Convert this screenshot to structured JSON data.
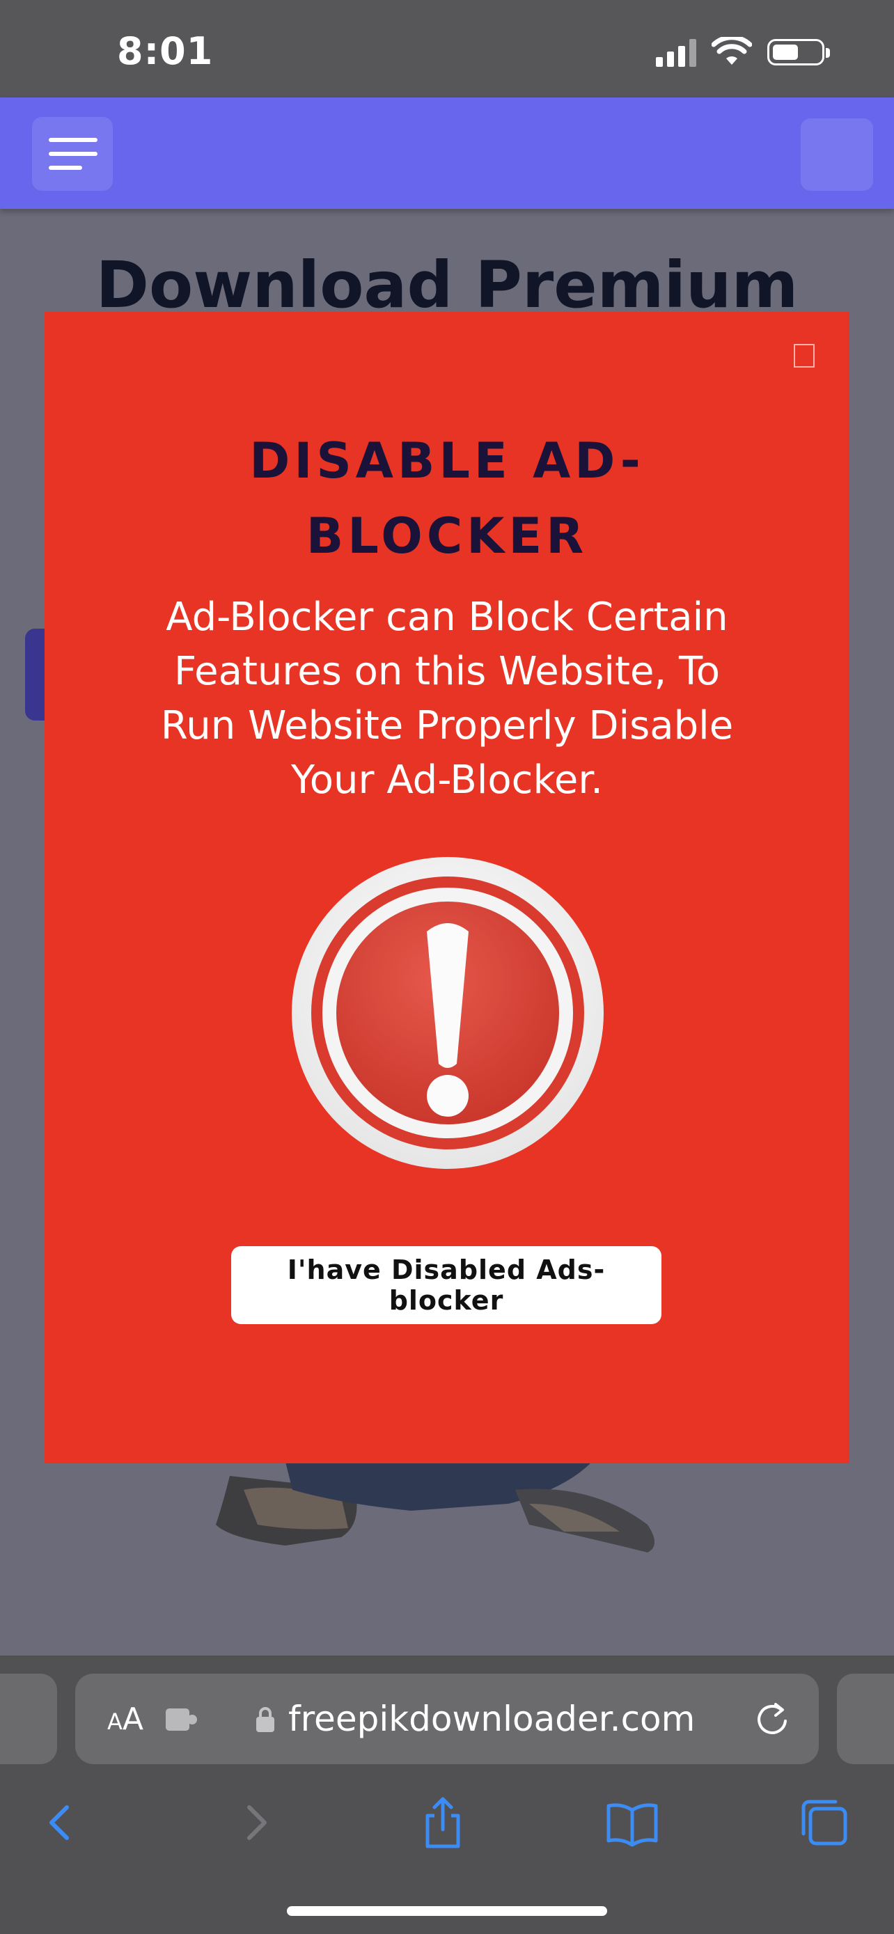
{
  "status_bar": {
    "time": "8:01"
  },
  "page": {
    "title": "Download Premium"
  },
  "modal": {
    "heading_line1": "DISABLE AD-",
    "heading_line2": "BLOCKER",
    "body_line1": "Ad-Blocker can Block Certain",
    "body_line2": "Features on this Website, To",
    "body_line3": "Run Website Properly Disable",
    "body_line4": "Your Ad-Blocker.",
    "button_label": "I'have Disabled Ads-blocker"
  },
  "browser": {
    "aa_small": "A",
    "aa_large": "A",
    "url": "freepikdownloader.com"
  },
  "icons": {
    "menu": "hamburger-icon",
    "close": "close-icon",
    "alert": "exclamation-alert-icon",
    "lock": "lock-icon",
    "extension": "puzzle-extension-icon",
    "reload": "reload-icon",
    "back": "chevron-left-icon",
    "forward": "chevron-right-icon",
    "share": "share-icon",
    "bookmarks": "book-icon",
    "tabs": "tabs-icon"
  },
  "colors": {
    "header": "#6866ec",
    "modal_bg": "#e83424",
    "heading": "#1a1239",
    "nav_accent": "#3c8cf6"
  }
}
